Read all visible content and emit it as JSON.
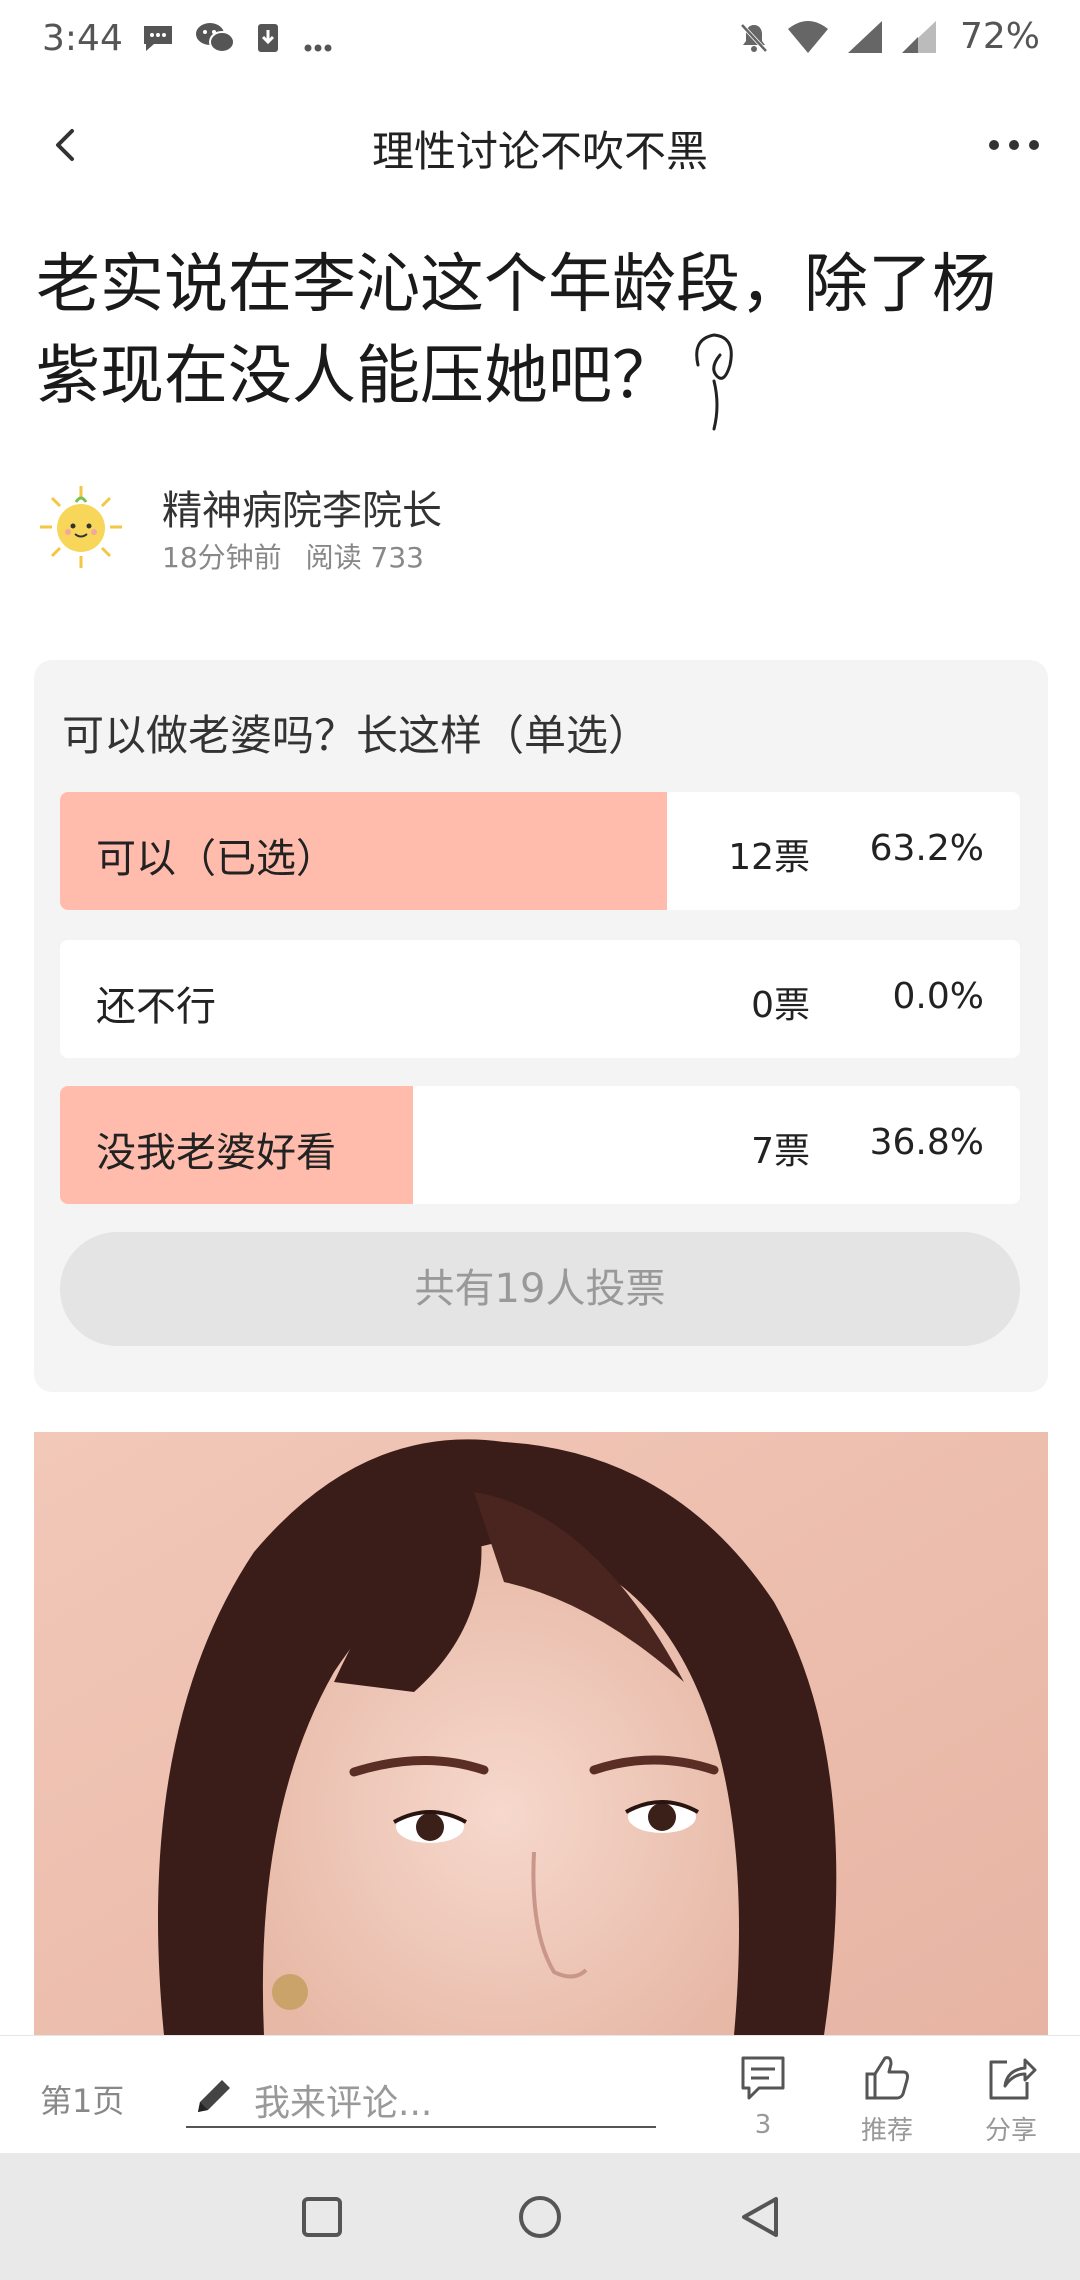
{
  "status_bar": {
    "time": "3:44",
    "battery": "72%",
    "notifications": [
      "chat-bubble-icon",
      "wechat-icon",
      "download-icon",
      "more-dots-icon"
    ],
    "right_icons": [
      "mute-icon",
      "wifi-icon",
      "signal-icon",
      "signal-weak-icon"
    ]
  },
  "header": {
    "title": "理性讨论不吹不黑"
  },
  "post": {
    "title": "老实说在李沁这个年龄段，除了杨紫现在没人能压她吧？"
  },
  "author": {
    "name": "精神病院李院长",
    "time_ago": "18分钟前",
    "reads": "阅读 733"
  },
  "poll": {
    "question": "可以做老婆吗？长这样（单选）",
    "options": [
      {
        "label": "可以（已选）",
        "votes": "12票",
        "percent": "63.2%",
        "fill": 0.632
      },
      {
        "label": "还不行",
        "votes": "0票",
        "percent": "0.0%",
        "fill": 0.0
      },
      {
        "label": "没我老婆好看",
        "votes": "7票",
        "percent": "36.8%",
        "fill": 0.368
      }
    ],
    "total": "共有19人投票"
  },
  "bottom_bar": {
    "page": "第1页",
    "comment_placeholder": "我来评论...",
    "comment_count": "3",
    "like_label": "推荐",
    "share_label": "分享"
  },
  "colors": {
    "poll_fill": "#ffbcad",
    "poll_bg": "#f4f4f4"
  }
}
